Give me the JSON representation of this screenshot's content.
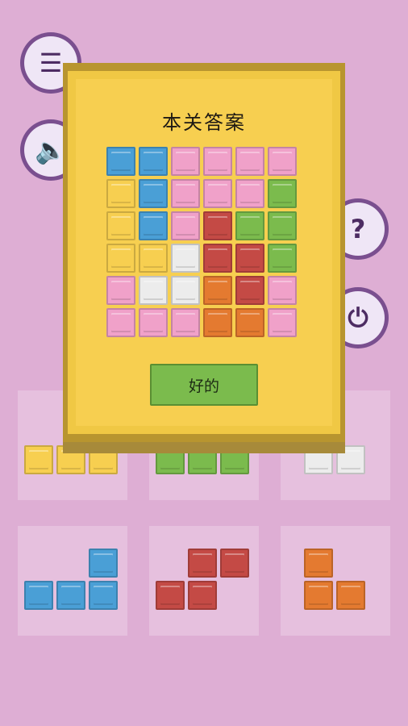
{
  "colors": {
    "background": "#deaed4",
    "tile_area": "#e6c0de",
    "modal_gold": "#f7cf50",
    "blue": "#4a9fd6",
    "yellow": "#f7cf50",
    "pink": "#f0a1c9",
    "green": "#7bbb4d",
    "red": "#c44a45",
    "white": "#ececec",
    "orange": "#e47a30"
  },
  "side_buttons": [
    {
      "name": "menu-list-icon",
      "glyph": "☰"
    },
    {
      "name": "sound-speaker-icon",
      "glyph": "🔈"
    },
    {
      "name": "help-question-icon",
      "glyph": "?"
    },
    {
      "name": "power-restart-icon",
      "glyph": "⏻"
    }
  ],
  "modal": {
    "title": "本关答案",
    "ok_label": "好的"
  },
  "answer_board": [
    [
      "blue",
      "blue",
      "pink",
      "pink",
      "pink",
      "pink"
    ],
    [
      "yellow",
      "blue",
      "pink",
      "pink",
      "pink",
      "green"
    ],
    [
      "yellow",
      "blue",
      "pink",
      "red",
      "green",
      "green"
    ],
    [
      "yellow",
      "yellow",
      "white",
      "red",
      "red",
      "green"
    ],
    [
      "pink",
      "white",
      "white",
      "orange",
      "red",
      "pink"
    ],
    [
      "pink",
      "pink",
      "pink",
      "orange",
      "orange",
      "pink"
    ]
  ],
  "pieces": [
    {
      "name": "yellow-piece",
      "color": "yellow",
      "cells": [
        [
          0,
          0
        ],
        [
          1,
          0
        ],
        [
          2,
          0
        ]
      ]
    },
    {
      "name": "green-piece",
      "color": "green",
      "cells": [
        [
          0,
          0
        ],
        [
          1,
          0
        ],
        [
          2,
          0
        ]
      ]
    },
    {
      "name": "white-piece",
      "color": "white",
      "cells": [
        [
          0,
          0
        ],
        [
          1,
          0
        ]
      ]
    },
    {
      "name": "blue-piece",
      "color": "blue",
      "cells": [
        [
          2,
          0
        ],
        [
          0,
          1
        ],
        [
          1,
          1
        ],
        [
          2,
          1
        ]
      ]
    },
    {
      "name": "red-piece",
      "color": "red",
      "cells": [
        [
          1,
          0
        ],
        [
          2,
          0
        ],
        [
          0,
          1
        ],
        [
          1,
          1
        ]
      ]
    },
    {
      "name": "orange-piece",
      "color": "orange",
      "cells": [
        [
          0,
          0
        ],
        [
          0,
          1
        ],
        [
          1,
          1
        ]
      ]
    }
  ]
}
